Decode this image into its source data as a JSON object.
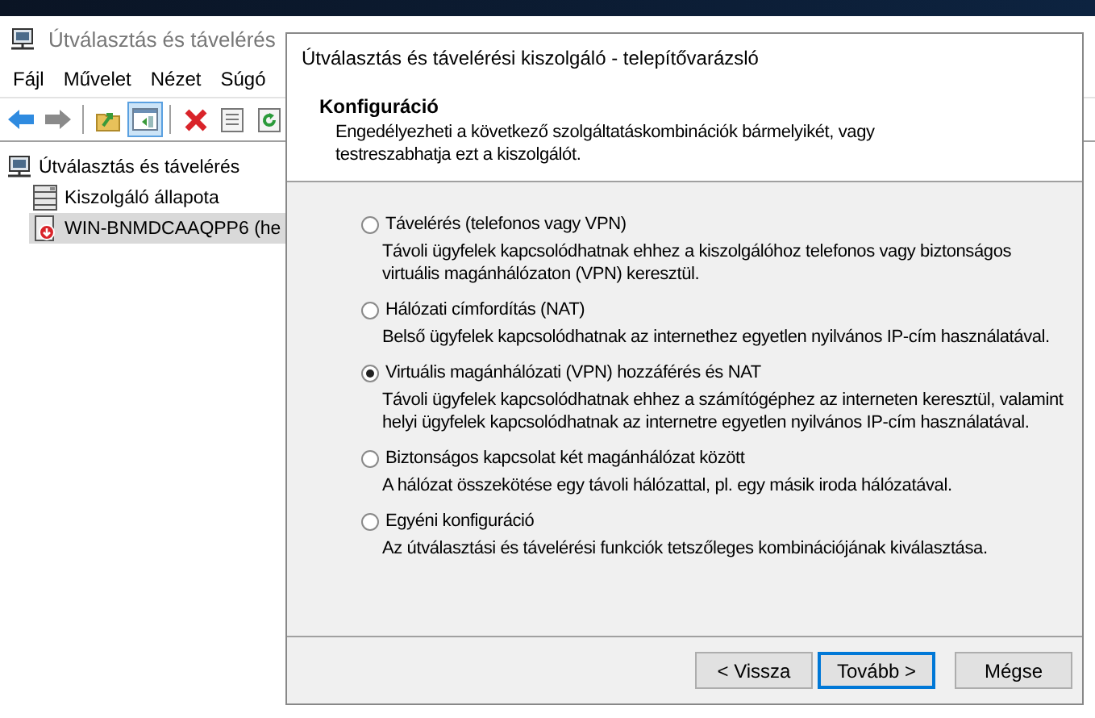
{
  "main_window": {
    "title": "Útválasztás és távelérés",
    "menu": [
      "Fájl",
      "Művelet",
      "Nézet",
      "Súgó"
    ],
    "toolbar": [
      {
        "kind": "back",
        "selected": false
      },
      {
        "kind": "forward",
        "selected": false
      },
      {
        "kind": "separator"
      },
      {
        "kind": "up",
        "selected": false
      },
      {
        "kind": "tree",
        "selected": true
      },
      {
        "kind": "separator"
      },
      {
        "kind": "delete",
        "selected": false
      },
      {
        "kind": "properties",
        "selected": false
      },
      {
        "kind": "refresh",
        "selected": false
      }
    ],
    "tree": [
      {
        "label": "Útválasztás és távelérés",
        "selected": false,
        "children": [
          {
            "label": "Kiszolgáló állapota",
            "selected": false
          },
          {
            "label": "WIN-BNMDCAAQPP6 (he",
            "selected": true
          }
        ]
      }
    ]
  },
  "dialog": {
    "title": "Útválasztás és távelérési kiszolgáló - telepítővarázsló",
    "heading": "Konfiguráció",
    "subtitle": "Engedélyezheti a következő szolgáltatáskombinációk bármelyikét, vagy testreszabhatja ezt a kiszolgálót.",
    "options": [
      {
        "label": "Távelérés (telefonos vagy VPN)",
        "description": "Távoli ügyfelek kapcsolódhatnak ehhez a kiszolgálóhoz telefonos vagy biztonságos virtuális magánhálózaton (VPN) keresztül.",
        "selected": false
      },
      {
        "label": "Hálózati címfordítás (NAT)",
        "description": "Belső ügyfelek kapcsolódhatnak az internethez egyetlen nyilvános IP-cím használatával.",
        "selected": false
      },
      {
        "label": "Virtuális magánhálózati (VPN) hozzáférés és NAT",
        "description": "Távoli ügyfelek kapcsolódhatnak ehhez a számítógéphez az interneten keresztül, valamint helyi ügyfelek kapcsolódhatnak az internetre egyetlen nyilvános IP-cím használatával.",
        "selected": true
      },
      {
        "label": "Biztonságos kapcsolat két magánhálózat között",
        "description": "A hálózat összekötése egy távoli hálózattal, pl. egy másik iroda hálózatával.",
        "selected": false
      },
      {
        "label": "Egyéni konfiguráció",
        "description": "Az útválasztási és távelérési funkciók tetszőleges kombinációjának kiválasztása.",
        "selected": false
      }
    ],
    "buttons": [
      {
        "label": "< Vissza",
        "focused": false
      },
      {
        "label": "Tovább >",
        "focused": true
      },
      {
        "label": "Mégse",
        "focused": false
      }
    ]
  }
}
